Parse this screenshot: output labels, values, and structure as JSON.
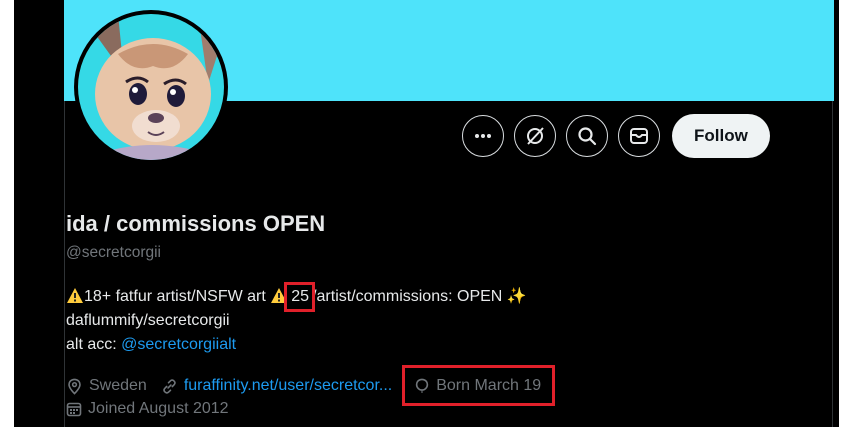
{
  "colors": {
    "banner": "#4ee3fa",
    "background": "#000000",
    "link": "#1d9bf0",
    "muted": "#71767b",
    "highlight_box": "#e0202a"
  },
  "profile": {
    "display_name": "ida / commissions OPEN",
    "handle": "@secretcorgii"
  },
  "actions": {
    "more_icon": "more-icon",
    "grok_icon": "grok-icon",
    "search_icon": "search-icon",
    "message_icon": "message-icon",
    "follow_label": "Follow"
  },
  "bio": {
    "line1_a": "18+ fatfur artist/NSFW art",
    "line1_b": "25",
    "line1_c": "/artist/commissions: OPEN",
    "line1_sparkle": "✨",
    "line2": "daflummify/secretcorgii",
    "line3_prefix": "alt acc: ",
    "line3_link": "@secretcorgiialt"
  },
  "meta": {
    "location": "Sweden",
    "website": "furaffinity.net/user/secretcor...",
    "birthday": "Born March 19",
    "joined": "Joined August 2012"
  }
}
